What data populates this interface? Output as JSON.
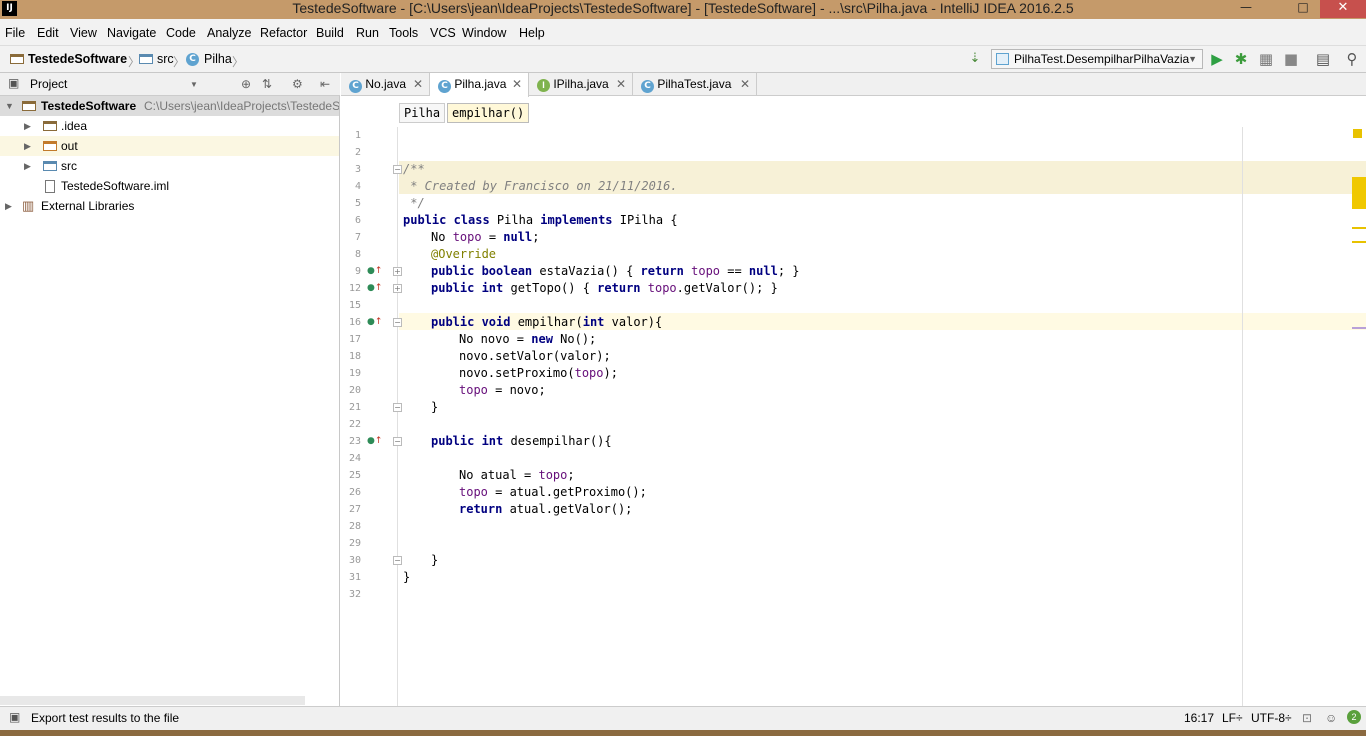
{
  "window": {
    "title": "TestedeSoftware - [C:\\Users\\jean\\IdeaProjects\\TestedeSoftware] - [TestedeSoftware] - ...\\src\\Pilha.java - IntelliJ IDEA 2016.2.5",
    "app_icon": "IJ",
    "minimize": "—",
    "maximize": "□",
    "close": "✕"
  },
  "menu": [
    "File",
    "Edit",
    "View",
    "Navigate",
    "Code",
    "Analyze",
    "Refactor",
    "Build",
    "Run",
    "Tools",
    "VCS",
    "Window",
    "Help"
  ],
  "navbar": {
    "project": "TestedeSoftware",
    "folder": "src",
    "class": "Pilha",
    "run_config": "PilhaTest.DesempilharPilhaVazia",
    "class_icon": "C"
  },
  "project_panel": {
    "title": "Project",
    "tree": [
      {
        "label": "TestedeSoftware",
        "path": "C:\\Users\\jean\\IdeaProjects\\TestedeSo",
        "level": 0,
        "expanded": true
      },
      {
        "label": ".idea",
        "level": 1
      },
      {
        "label": "out",
        "level": 1
      },
      {
        "label": "src",
        "level": 1
      },
      {
        "label": "TestedeSoftware.iml",
        "level": 1
      },
      {
        "label": "External Libraries",
        "level": 0
      }
    ]
  },
  "tabs": [
    {
      "label": "No.java",
      "icon": "C"
    },
    {
      "label": "Pilha.java",
      "icon": "C",
      "active": true
    },
    {
      "label": "IPilha.java",
      "icon": "I"
    },
    {
      "label": "PilhaTest.java",
      "icon": "C"
    }
  ],
  "tab_close": "✕",
  "breadcrumb": [
    "Pilha",
    "empilhar()"
  ],
  "code": {
    "line_numbers": [
      "1",
      "2",
      "3",
      "4",
      "5",
      "6",
      "7",
      "8",
      "9",
      "12",
      "15",
      "16",
      "17",
      "18",
      "19",
      "20",
      "21",
      "22",
      "23",
      "24",
      "25",
      "26",
      "27",
      "28",
      "29",
      "30",
      "31",
      "32"
    ],
    "l3": "/**",
    "l4": " * Created by Francisco on 21/11/2016.",
    "l5": " */",
    "l6a": "public class",
    "l6b": " Pilha ",
    "l6c": "implements",
    "l6d": " IPilha {",
    "l7a": "No ",
    "l7b": "topo",
    "l7c": " = ",
    "l7d": "null",
    "l7e": ";",
    "l8": "@Override",
    "l9a": "public boolean",
    "l9b": " estaVazia() { ",
    "l9c": "return",
    "l9d": " topo",
    "l9e": " == ",
    "l9f": "null",
    "l9g": "; }",
    "l12a": "public int",
    "l12b": " getTopo() { ",
    "l12c": "return",
    "l12d": " topo",
    "l12e": ".getValor(); }",
    "l16a": "public void",
    "l16b": " empilhar(",
    "l16c": "int",
    "l16d": " valor){",
    "l17a": "No novo = ",
    "l17b": "new",
    "l17c": " No();",
    "l18": "novo.setValor(valor);",
    "l19a": "novo.setProximo(",
    "l19b": "topo",
    "l19c": ");",
    "l20a": "topo",
    "l20b": " = novo;",
    "l21": "}",
    "l23a": "public int",
    "l23b": " desempilhar(){",
    "l25a": "No atual = ",
    "l25b": "topo",
    "l25c": ";",
    "l26a": "topo",
    "l26b": " = atual.getProximo();",
    "l27a": "return",
    "l27b": " atual.getValor();",
    "l30": "}",
    "l31": "}"
  },
  "status": {
    "message": "Export test results to the file",
    "position": "16:17",
    "line_sep": "LF÷",
    "encoding": "UTF-8÷",
    "badge": "2"
  }
}
